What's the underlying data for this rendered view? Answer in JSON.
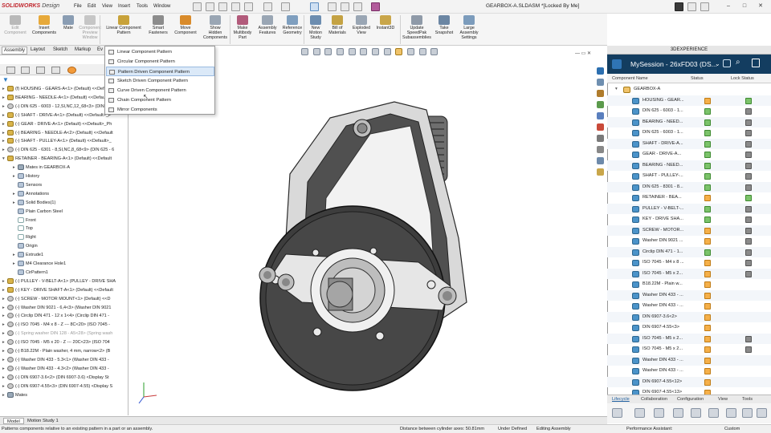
{
  "app": {
    "logo_brand": "SOLIDWORKS",
    "logo_suffix": "Design",
    "document_title": "GEARBOX-A.SLDASM *[Locked By Me]"
  },
  "menu": [
    "File",
    "Edit",
    "View",
    "Insert",
    "Tools",
    "Window"
  ],
  "ribbon": [
    {
      "label": "Edit\nComponent",
      "disabled": true,
      "color": "#b9b9b9"
    },
    {
      "label": "Insert\nComponents",
      "disabled": false,
      "color": "#e7a93a"
    },
    {
      "label": "Mate",
      "disabled": false,
      "color": "#8a9db3"
    },
    {
      "label": "Component\nPreview\nWindow",
      "disabled": true,
      "color": "#c6c6c6"
    },
    {
      "label": "Linear Component\nPattern",
      "disabled": false,
      "color": "#c8a23a"
    },
    {
      "label": "Smart\nFasteners",
      "disabled": false,
      "color": "#8c8c8c"
    },
    {
      "label": "Move\nComponent",
      "disabled": false,
      "color": "#d98b2b"
    },
    {
      "label": "Show\nHidden\nComponents",
      "disabled": false,
      "color": "#9aa6b4"
    },
    {
      "label": "Make\nMultibody\nPart",
      "disabled": false,
      "color": "#b25b7b"
    },
    {
      "label": "Assembly\nFeatures",
      "disabled": false,
      "color": "#9aa6b4"
    },
    {
      "label": "Reference\nGeometry",
      "disabled": false,
      "color": "#7f9fbf"
    },
    {
      "label": "New\nMotion\nStudy",
      "disabled": false,
      "color": "#6c8db0"
    },
    {
      "label": "Bill of\nMaterials",
      "disabled": false,
      "color": "#c4a243"
    },
    {
      "label": "Exploded\nView",
      "disabled": false,
      "color": "#9aa6b4"
    },
    {
      "label": "Instant3D",
      "disabled": false,
      "color": "#c9a64a"
    },
    {
      "label": "Update\nSpeedPak\nSubassemblies",
      "disabled": false,
      "color": "#8f9aa8"
    },
    {
      "label": "Take\nSnapshot",
      "disabled": false,
      "color": "#6b86a3"
    },
    {
      "label": "Large\nAssembly\nSettings",
      "disabled": false,
      "color": "#7c9cbc"
    }
  ],
  "command_tabs": [
    "Assembly",
    "Layout",
    "Sketch",
    "Markup",
    "Ev"
  ],
  "dropdown": {
    "items": [
      "Linear Component Pattern",
      "Circular Component Pattern",
      "Pattern Driven Component Pattern",
      "Sketch Driven Component Pattern",
      "Curve Driven Component Pattern",
      "Chain Component Pattern",
      "Mirror Components"
    ],
    "highlighted_index": 2
  },
  "tree": [
    {
      "indent": 0,
      "icon": "part",
      "text": "(f) HOUSING - GEARS-A<1> (Default) <<Default",
      "tw": "▸"
    },
    {
      "indent": 0,
      "icon": "part",
      "text": "BEARING - NEEDLE-A<1> (Default) <<Default>",
      "tw": "▸"
    },
    {
      "indent": 0,
      "icon": "screw",
      "text": "(-) DIN 625 - 6003 - 12,SI,NC,12_68<3> (DIN 625 -",
      "tw": "▸"
    },
    {
      "indent": 0,
      "icon": "part",
      "text": "(-) SHAFT - DRIVE-A<1> (Default) <<Default>_P",
      "tw": "▸"
    },
    {
      "indent": 0,
      "icon": "part",
      "text": "(-) GEAR - DRIVE-A<1> (Default) <<Default>_Ph",
      "tw": "▸"
    },
    {
      "indent": 0,
      "icon": "part",
      "text": "(-) BEARING - NEEDLE-A<2> (Default) <<Default",
      "tw": "▸"
    },
    {
      "indent": 0,
      "icon": "part",
      "text": "(-) SHAFT - PULLEY-A<1> (Default) <<Default>_",
      "tw": "▸"
    },
    {
      "indent": 0,
      "icon": "screw",
      "text": "(-) DIN 625 - 6301 - 8,SI,NC,8_68<9> (DIN 625 - 6",
      "tw": "▸"
    },
    {
      "indent": 0,
      "icon": "part",
      "text": "RETAINER - BEARING-A<1> (Default) <<Default",
      "tw": "▾"
    },
    {
      "indent": 1,
      "icon": "mates",
      "text": "Mates in GEARBOX-A",
      "tw": "▸"
    },
    {
      "indent": 1,
      "icon": "feat",
      "text": "History",
      "tw": "▸"
    },
    {
      "indent": 1,
      "icon": "feat",
      "text": "Sensors",
      "tw": ""
    },
    {
      "indent": 1,
      "icon": "feat",
      "text": "Annotations",
      "tw": "▸"
    },
    {
      "indent": 1,
      "icon": "feat",
      "text": "Solid Bodies(1)",
      "tw": "▸"
    },
    {
      "indent": 1,
      "icon": "feat",
      "text": "Plain Carbon Steel",
      "tw": ""
    },
    {
      "indent": 1,
      "icon": "plane",
      "text": "Front",
      "tw": ""
    },
    {
      "indent": 1,
      "icon": "plane",
      "text": "Top",
      "tw": ""
    },
    {
      "indent": 1,
      "icon": "plane",
      "text": "Right",
      "tw": ""
    },
    {
      "indent": 1,
      "icon": "feat",
      "text": "Origin",
      "tw": ""
    },
    {
      "indent": 1,
      "icon": "feat",
      "text": "Extrude1",
      "tw": "▸"
    },
    {
      "indent": 1,
      "icon": "feat",
      "text": "M4 Clearance Hole1",
      "tw": "▸"
    },
    {
      "indent": 1,
      "icon": "feat",
      "text": "CirPattern1",
      "tw": ""
    },
    {
      "indent": 0,
      "icon": "part",
      "text": "(-) PULLEY - V-BELT-A<1> (PULLEY - DRIVE SHA",
      "tw": "▸"
    },
    {
      "indent": 0,
      "icon": "part",
      "text": "(-) KEY - DRIVE SHAFT-A<1> (Default) <<Default",
      "tw": "▸"
    },
    {
      "indent": 0,
      "icon": "screw",
      "text": "(-) SCREW - MOTOR MOUNT<1> (Default) <<D",
      "tw": "▸"
    },
    {
      "indent": 0,
      "icon": "screw",
      "text": "(-) Washer DIN 9021 - 6,4<3> (Washer DIN 9021",
      "tw": "▸"
    },
    {
      "indent": 0,
      "icon": "screw",
      "text": "(-) Circlip DIN 471 - 12 x 1<4> (Circlip DIN 471 -",
      "tw": "▸"
    },
    {
      "indent": 0,
      "icon": "screw",
      "text": "(-) ISO 7045 - M4 x 8 - Z --- 8C<20> (ISO 7045 -",
      "tw": "▸"
    },
    {
      "indent": 0,
      "icon": "screw",
      "text": "(-) Spring washer DIN 128 - A5<28> (Spring wash",
      "tw": "▸",
      "grey": true
    },
    {
      "indent": 0,
      "icon": "screw",
      "text": "(-) ISO 7045 - M5 x 20 - Z --- 20C<23> (ISO 704",
      "tw": "▸"
    },
    {
      "indent": 0,
      "icon": "screw",
      "text": "(-) B18.22M - Plain washer, 4 mm, narrow<2> (B",
      "tw": "▸"
    },
    {
      "indent": 0,
      "icon": "screw",
      "text": "(-) Washer DIN 433 - 5.3<1> (Washer DIN 433 -",
      "tw": "▸"
    },
    {
      "indent": 0,
      "icon": "screw",
      "text": "(-) Washer DIN 433 - 4.3<2> (Washer DIN 433 -",
      "tw": "▸"
    },
    {
      "indent": 0,
      "icon": "screw",
      "text": "(-) DIN 6907-3.6<2> (DIN 6907-3.6) <Display St",
      "tw": "▸"
    },
    {
      "indent": 0,
      "icon": "screw",
      "text": "(-) DIN 6907-4.55<3> (DIN 6907-4.55) <Display S",
      "tw": "▸"
    },
    {
      "indent": 0,
      "icon": "mates",
      "text": "Mates",
      "tw": "▸"
    }
  ],
  "xpanel": {
    "header": "3DEXPERIENCE",
    "session": "MySession - 26xFD03 (DS...",
    "columns": {
      "name": "Component Name",
      "status": "Status",
      "lock": "Lock Status"
    },
    "root": "GEARBOX-A",
    "rows": [
      {
        "name": "HOUSING - GEAR...",
        "status": "orange",
        "lock": "green"
      },
      {
        "name": "DIN 625 - 6003 - 1...",
        "status": "green",
        "lock": "grey"
      },
      {
        "name": "BEARING - NEED...",
        "status": "green",
        "lock": "grey"
      },
      {
        "name": "DIN 625 - 6003 - 1...",
        "status": "green",
        "lock": "grey"
      },
      {
        "name": "SHAFT - DRIVE-A...",
        "status": "green",
        "lock": "grey"
      },
      {
        "name": "GEAR - DRIVE-A...",
        "status": "green",
        "lock": "grey"
      },
      {
        "name": "BEARING - NEED...",
        "status": "green",
        "lock": "grey"
      },
      {
        "name": "SHAFT - PULLEY-...",
        "status": "green",
        "lock": "grey"
      },
      {
        "name": "DIN 625 - 8301 - 8...",
        "status": "green",
        "lock": "grey"
      },
      {
        "name": "RETAINER - BEA...",
        "status": "orange",
        "lock": "green"
      },
      {
        "name": "PULLEY - V-BELT-...",
        "status": "green",
        "lock": "grey"
      },
      {
        "name": "KEY - DRIVE SHA...",
        "status": "green",
        "lock": "grey"
      },
      {
        "name": "SCREW - MOTOR...",
        "status": "orange",
        "lock": "grey"
      },
      {
        "name": "Washer DIN 9021 ...",
        "status": "orange",
        "lock": "grey"
      },
      {
        "name": "Circlip DIN 471 - 1...",
        "status": "green",
        "lock": "grey"
      },
      {
        "name": "ISO 7045 - M4 x 8 ...",
        "status": "orange",
        "lock": "grey"
      },
      {
        "name": "ISO 7045 - M5 x 2...",
        "status": "orange",
        "lock": "grey"
      },
      {
        "name": "B18.22M - Plain w...",
        "status": "orange",
        "lock": "none"
      },
      {
        "name": "Washer DIN 433 - ...",
        "status": "orange",
        "lock": "none"
      },
      {
        "name": "Washer DIN 433 - ...",
        "status": "orange",
        "lock": "none"
      },
      {
        "name": "DIN 6907-3.6<2>",
        "status": "orange",
        "lock": "none"
      },
      {
        "name": "DIN 6907-4.55<3>",
        "status": "orange",
        "lock": "none"
      },
      {
        "name": "ISO 7045 - M5 x 2...",
        "status": "orange",
        "lock": "grey"
      },
      {
        "name": "ISO 7045 - M5 x 2...",
        "status": "orange",
        "lock": "grey"
      },
      {
        "name": "Washer DIN 433 - ...",
        "status": "orange",
        "lock": "none"
      },
      {
        "name": "Washer DIN 433 - ...",
        "status": "orange",
        "lock": "none"
      },
      {
        "name": "DIN 6907-4.55<12>",
        "status": "orange",
        "lock": "none"
      },
      {
        "name": "DIN 6907-4.55<13>",
        "status": "orange",
        "lock": "none"
      }
    ],
    "tabs": [
      "Lifecycle",
      "Collaboration",
      "Configuration",
      "View",
      "Tools"
    ]
  },
  "bottom_tabs": [
    "Model",
    "Motion Study 1"
  ],
  "status": {
    "message": "Patterns components relative to an existing pattern in a part or an assembly.",
    "distance": "Distance between cylinder axes: 50.81mm",
    "under_defined": "Under Defined",
    "editing": "Editing Assembly",
    "performance": "Performance Assistant:",
    "custom": "Custom"
  },
  "colors": {
    "accent": "#133d60",
    "highlight": "#dbe9f8",
    "logo_red": "#c0262d"
  }
}
